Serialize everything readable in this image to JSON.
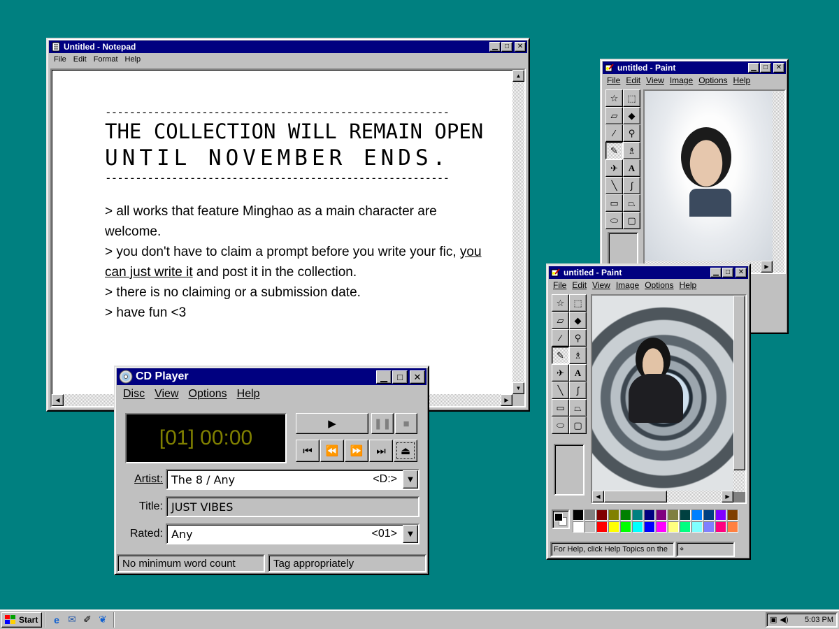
{
  "notepad": {
    "title": "Untitled - Notepad",
    "menu": [
      "File",
      "Edit",
      "Format",
      "Help"
    ],
    "dashes": "---------------------------------------------------------",
    "headline_1": "THE COLLECTION WILL REMAIN OPEN",
    "headline_2": "UNTIL NOVEMBER ENDS.",
    "lines": {
      "l1": "> all works that feature Minghao as a main character are welcome.",
      "l2a": "> you don't have to claim a prompt before you write your fic, ",
      "l2u": "you can just write it",
      "l2b": " and post it in the collection.",
      "l3": "> there is no claiming or a submission date.",
      "l4": "> have fun <3"
    }
  },
  "cd_player": {
    "title": "CD Player",
    "menu": [
      "Disc",
      "View",
      "Options",
      "Help"
    ],
    "display": "[01] 00:00",
    "artist_label": "Artist:",
    "artist_value": "The 8 / Any",
    "artist_drive": "<D:>",
    "title_label": "Title:",
    "title_value": "JUST VIBES",
    "rated_label": "Rated:",
    "rated_value": "Any",
    "rated_track": "<01>",
    "status_left": "No minimum word count",
    "status_right": "Tag appropriately"
  },
  "paint_back": {
    "title": "untitled - Paint",
    "menu": [
      "File",
      "Edit",
      "View",
      "Image",
      "Options",
      "Help"
    ]
  },
  "paint_front": {
    "title": "untitled - Paint",
    "menu": [
      "File",
      "Edit",
      "View",
      "Image",
      "Options",
      "Help"
    ],
    "status": "For Help, click Help Topics on the"
  },
  "palette_colors": [
    "#000000",
    "#808080",
    "#800000",
    "#808000",
    "#008000",
    "#008080",
    "#000080",
    "#800080",
    "#808040",
    "#004040",
    "#0080ff",
    "#004080",
    "#8000ff",
    "#804000",
    "#ffffff",
    "#c0c0c0",
    "#ff0000",
    "#ffff00",
    "#00ff00",
    "#00ffff",
    "#0000ff",
    "#ff00ff",
    "#ffff80",
    "#00ff80",
    "#80ffff",
    "#8080ff",
    "#ff0080",
    "#ff8040"
  ],
  "taskbar": {
    "start": "Start",
    "time": "5:03 PM"
  }
}
